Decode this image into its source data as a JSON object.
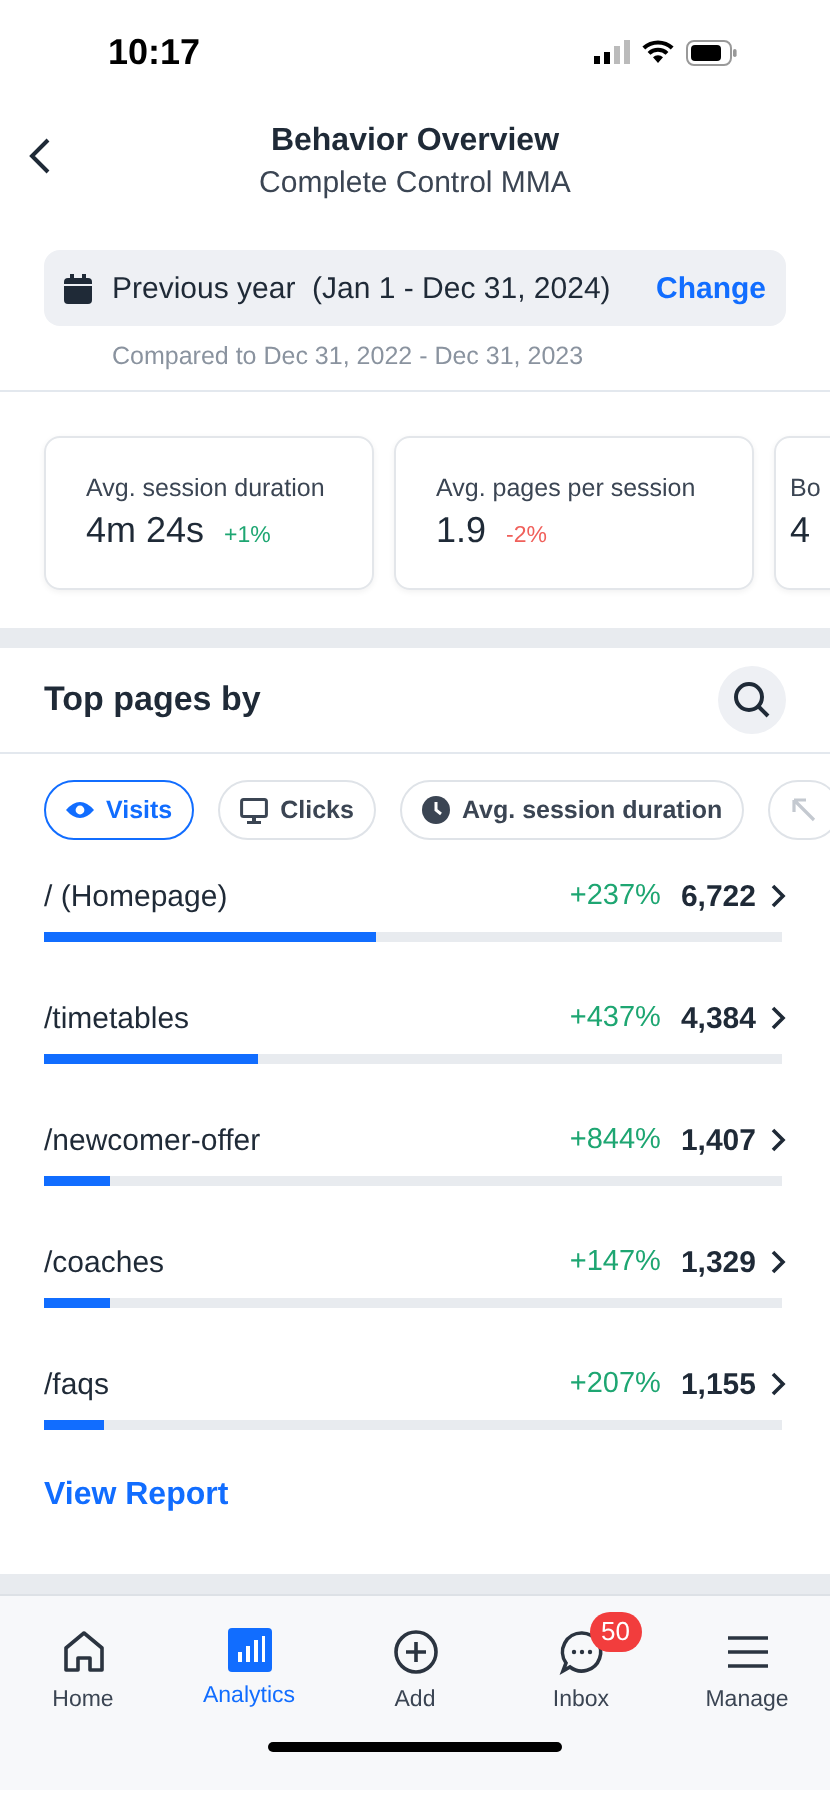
{
  "status_bar": {
    "time": "10:17"
  },
  "header": {
    "title": "Behavior Overview",
    "subtitle": "Complete Control MMA"
  },
  "date_range": {
    "label": "Previous year  (Jan 1 - Dec 31, 2024)",
    "action": "Change",
    "comparison": "Compared to Dec 31, 2022 - Dec 31, 2023"
  },
  "metrics": [
    {
      "label": "Avg. session duration",
      "value": "4m 24s",
      "change": "+1%",
      "color": "#1ea672"
    },
    {
      "label": "Avg. pages per session",
      "value": "1.9",
      "change": "-2%",
      "color": "#f0605b"
    },
    {
      "label": "Bo",
      "value": "4"
    }
  ],
  "top_pages": {
    "title": "Top pages by",
    "filters": [
      {
        "label": "Visits",
        "kind": "eye",
        "selected": true
      },
      {
        "label": "Clicks",
        "kind": "monitor",
        "selected": false
      },
      {
        "label": "Avg. session duration",
        "kind": "clock",
        "selected": false
      },
      {
        "kind": "arrow",
        "selected": false
      }
    ],
    "rows": [
      {
        "page": "/ (Homepage)",
        "change": "+237%",
        "color": "#1ea672",
        "count": "6,722",
        "level": 0.45
      },
      {
        "page": "/timetables",
        "change": "+437%",
        "color": "#1ea672",
        "count": "4,384",
        "level": 0.29
      },
      {
        "page": "/newcomer-offer",
        "change": "+844%",
        "color": "#1ea672",
        "count": "1,407",
        "level": 0.09
      },
      {
        "page": "/coaches",
        "change": "+147%",
        "color": "#1ea672",
        "count": "1,329",
        "level": 0.09
      },
      {
        "page": "/faqs",
        "change": "+207%",
        "color": "#1ea672",
        "count": "1,155",
        "level": 0.08
      }
    ],
    "link": "View Report"
  },
  "tab_bar": [
    {
      "label": "Home",
      "kind": "home",
      "selected": false
    },
    {
      "label": "Analytics",
      "kind": "chart",
      "selected": true
    },
    {
      "label": "Add",
      "kind": "plus",
      "selected": false
    },
    {
      "label": "Inbox",
      "kind": "chat",
      "badge": "50",
      "selected": false
    },
    {
      "label": "Manage",
      "kind": "menu",
      "selected": false
    }
  ]
}
